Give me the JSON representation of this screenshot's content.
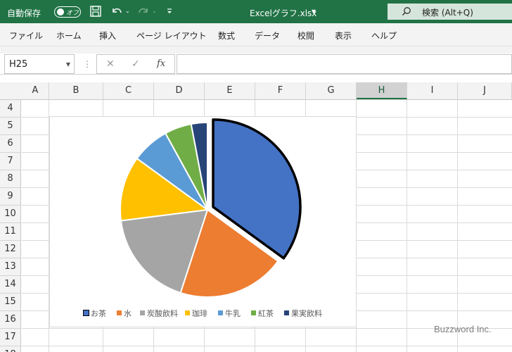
{
  "titlebar": {
    "autosave_label": "自動保存",
    "autosave_state": "オフ",
    "save_icon": "save-icon",
    "undo_icon": "undo-icon",
    "redo_icon": "redo-icon",
    "customize_icon": "customize-qat-icon",
    "filename": "Excelグラフ.xlsx",
    "search_placeholder": "検索 (Alt+Q)"
  },
  "menu": [
    "ファイル",
    "ホーム",
    "挿入",
    "ページ レイアウト",
    "数式",
    "データ",
    "校閲",
    "表示",
    "ヘルプ"
  ],
  "formula_bar": {
    "name_box": "H25",
    "cancel": "✕",
    "enter": "✓",
    "fx": "fx",
    "value": ""
  },
  "sheet": {
    "columns": [
      "A",
      "B",
      "C",
      "D",
      "E",
      "F",
      "G",
      "H",
      "I",
      "J"
    ],
    "selected_column": "H",
    "rows": [
      "4",
      "5",
      "6",
      "7",
      "8",
      "9",
      "10",
      "11",
      "12",
      "13",
      "14",
      "15",
      "16",
      "17",
      "18"
    ]
  },
  "chart_data": {
    "type": "pie",
    "title": "",
    "categories": [
      "お茶",
      "水",
      "炭酸飲料",
      "珈琲",
      "牛乳",
      "紅茶",
      "果実飲料"
    ],
    "values": [
      35,
      20,
      18,
      12,
      7,
      5,
      3
    ],
    "colors": [
      "#4472c4",
      "#ed7d31",
      "#a5a5a5",
      "#ffc000",
      "#5b9bd5",
      "#70ad47",
      "#264478"
    ],
    "exploded_slice": "お茶",
    "selected_slice": "お茶",
    "legend_position": "bottom"
  },
  "watermark": "Buzzword Inc."
}
